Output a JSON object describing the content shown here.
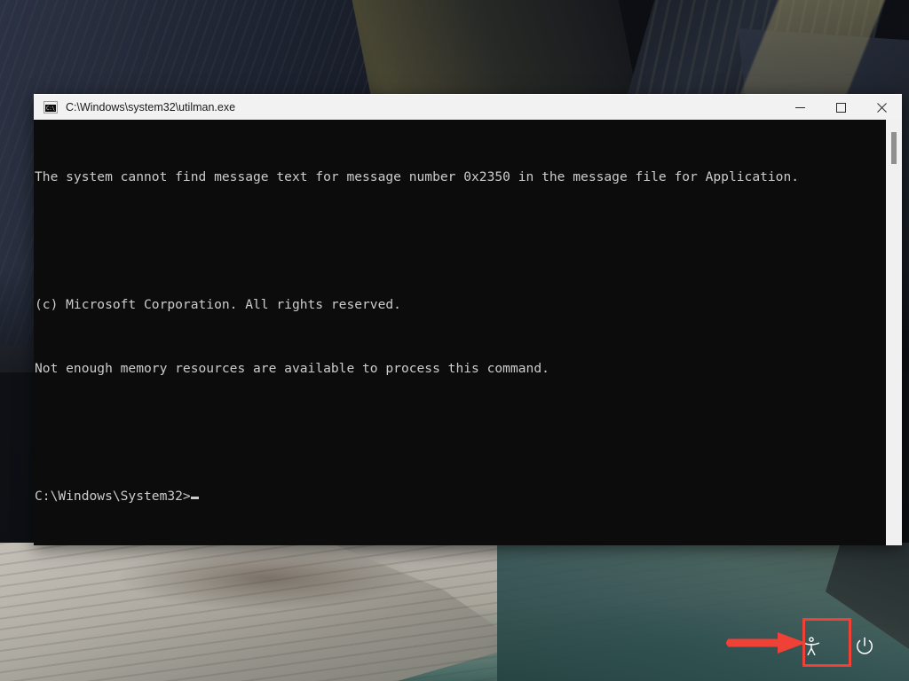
{
  "desktop": {
    "background_name": "windows-lock-screen-mountain-wallpaper",
    "background_colors": {
      "upper_rock": "#1d2230",
      "lower_rock": "#b0aca3",
      "water": "#3d5b58"
    }
  },
  "console_window": {
    "title": "C:\\Windows\\system32\\utilman.exe",
    "icon_name": "cmd-icon",
    "icon_glyph": "C:\\",
    "window_controls": {
      "minimize_label": "Minimize",
      "maximize_label": "Maximize",
      "close_label": "Close"
    },
    "colors": {
      "titlebar_bg": "#f2f2f3",
      "titlebar_text": "#1b1b1b",
      "console_bg": "#0c0c0c",
      "console_text": "#cccccc"
    },
    "output_lines": [
      "The system cannot find message text for message number 0x2350 in the message file for Application.",
      "",
      "(c) Microsoft Corporation. All rights reserved.",
      "Not enough memory resources are available to process this command.",
      ""
    ],
    "prompt": "C:\\Windows\\System32>",
    "scrollbar": {
      "name": "vertical-scrollbar",
      "thumb_position": "top"
    }
  },
  "lock_screen_buttons": [
    {
      "name": "ease-of-access-button",
      "label": "Ease of Access",
      "icon_name": "accessibility-icon",
      "highlighted": true
    },
    {
      "name": "power-button",
      "label": "Power",
      "icon_name": "power-icon",
      "highlighted": false
    }
  ],
  "annotations": {
    "arrow": {
      "name": "annotation-arrow",
      "direction": "right",
      "color": "#ef4136",
      "points_to": "ease-of-access-button"
    },
    "highlight_box": {
      "name": "annotation-highlight-box",
      "color": "#ef4136",
      "surrounds": "ease-of-access-button"
    }
  }
}
